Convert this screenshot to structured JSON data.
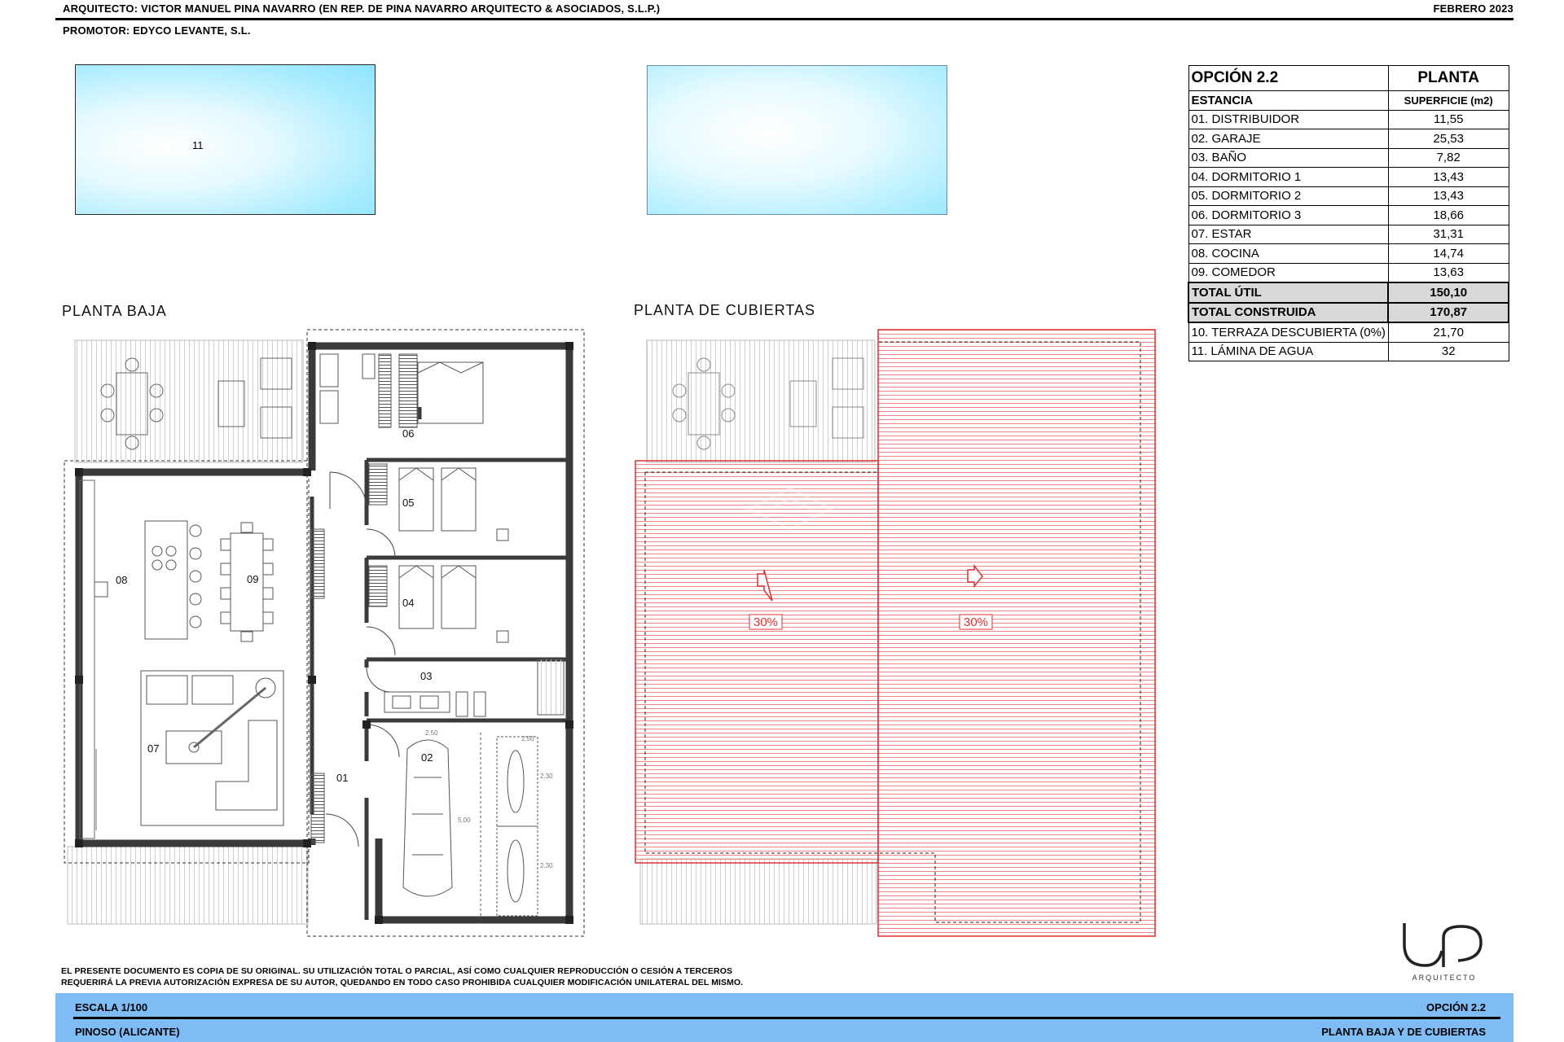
{
  "header": {
    "architect": "ARQUITECTO: VICTOR MANUEL PINA NAVARRO (EN REP. DE PINA NAVARRO ARQUITECTO & ASOCIADOS, S.L.P.)",
    "date": "FEBRERO 2023",
    "promoter": "PROMOTOR: EDYCO LEVANTE, S.L."
  },
  "plans": {
    "ground_title": "PLANTA BAJA",
    "roof_title": "PLANTA DE CUBIERTAS",
    "pool_label": "11",
    "room_labels": [
      "01",
      "02",
      "03",
      "04",
      "05",
      "06",
      "07",
      "08",
      "09"
    ],
    "slope_label": "30%",
    "dims": [
      "2.50",
      "2.30",
      "2.30",
      "5.00",
      "2.50"
    ]
  },
  "table": {
    "option": "OPCIÓN 2.2",
    "level": "PLANTA",
    "col_room": "ESTANCIA",
    "col_area": "SUPERFICIE (m2)",
    "rows": [
      {
        "name": "01. DISTRIBUIDOR",
        "area": "11,55"
      },
      {
        "name": "02. GARAJE",
        "area": "25,53"
      },
      {
        "name": "03. BAÑO",
        "area": "7,82"
      },
      {
        "name": "04. DORMITORIO 1",
        "area": "13,43"
      },
      {
        "name": "05. DORMITORIO 2",
        "area": "13,43"
      },
      {
        "name": "06. DORMITORIO 3",
        "area": "18,66"
      },
      {
        "name": "07. ESTAR",
        "area": "31,31"
      },
      {
        "name": "08. COCINA",
        "area": "14,74"
      },
      {
        "name": "09. COMEDOR",
        "area": "13,63"
      }
    ],
    "total_util": {
      "name": "TOTAL ÚTIL",
      "area": "150,10"
    },
    "total_construida": {
      "name": "TOTAL CONSTRUIDA",
      "area": "170,87"
    },
    "extra": [
      {
        "name": "10. TERRAZA DESCUBIERTA (0%)",
        "area": "21,70"
      },
      {
        "name": "11. LÁMINA DE AGUA",
        "area": "32"
      }
    ]
  },
  "logo": {
    "text": "ARQUITECTO"
  },
  "disclaimer": {
    "line1": "EL PRESENTE DOCUMENTO ES COPIA DE SU ORIGINAL. SU UTILIZACIÓN TOTAL O PARCIAL, ASÍ COMO CUALQUIER REPRODUCCIÓN O CESIÓN A TERCEROS",
    "line2": "REQUERIRÁ LA PREVIA AUTORIZACIÓN EXPRESA DE SU AUTOR, QUEDANDO EN TODO CASO PROHIBIDA CUALQUIER MODIFICACIÓN UNILATERAL DEL MISMO."
  },
  "footer": {
    "scale": "ESCALA 1/100",
    "option": "OPCIÓN 2.2",
    "location": "PINOSO (ALICANTE)",
    "sheet": "PLANTA BAJA Y DE CUBIERTAS"
  },
  "colors": {
    "pool": "#9fe8ff",
    "roof": "#e03030",
    "footer": "#7fbcf5",
    "total_fill": "#d9d9d9"
  }
}
